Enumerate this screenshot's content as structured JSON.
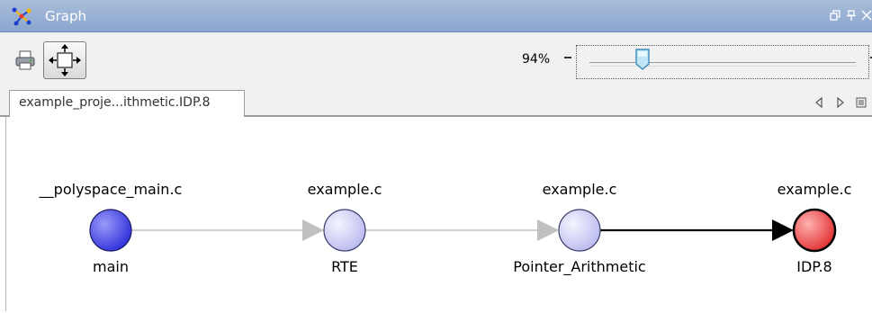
{
  "window": {
    "title": "Graph",
    "icon": "graph-app-icon"
  },
  "titlebar_controls": [
    "restore-icon",
    "pin-icon",
    "close-icon"
  ],
  "toolbar": {
    "print_icon": "printer-icon",
    "fit_icon": "fit-to-window-icon",
    "zoom_value": "94%",
    "zoom_slider_level_percent": 20
  },
  "tab": {
    "label": "example_proje...ithmetic.IDP.8",
    "nav_icons": [
      "scroll-left-icon",
      "scroll-right-icon",
      "tab-list-icon"
    ]
  },
  "graph": {
    "nodes": [
      {
        "file": "__polyspace_main.c",
        "name": "main",
        "color": "#3a3adf",
        "status": "source"
      },
      {
        "file": "example.c",
        "name": "RTE",
        "color": "#c8c8f5",
        "status": "intermediate"
      },
      {
        "file": "example.c",
        "name": "Pointer_Arithmetic",
        "color": "#c8c8f5",
        "status": "intermediate"
      },
      {
        "file": "example.c",
        "name": "IDP.8",
        "color": "#e83a3a",
        "status": "defect"
      }
    ],
    "edge_colors": {
      "inactive": "#c0c0c0",
      "active": "#000000"
    }
  }
}
